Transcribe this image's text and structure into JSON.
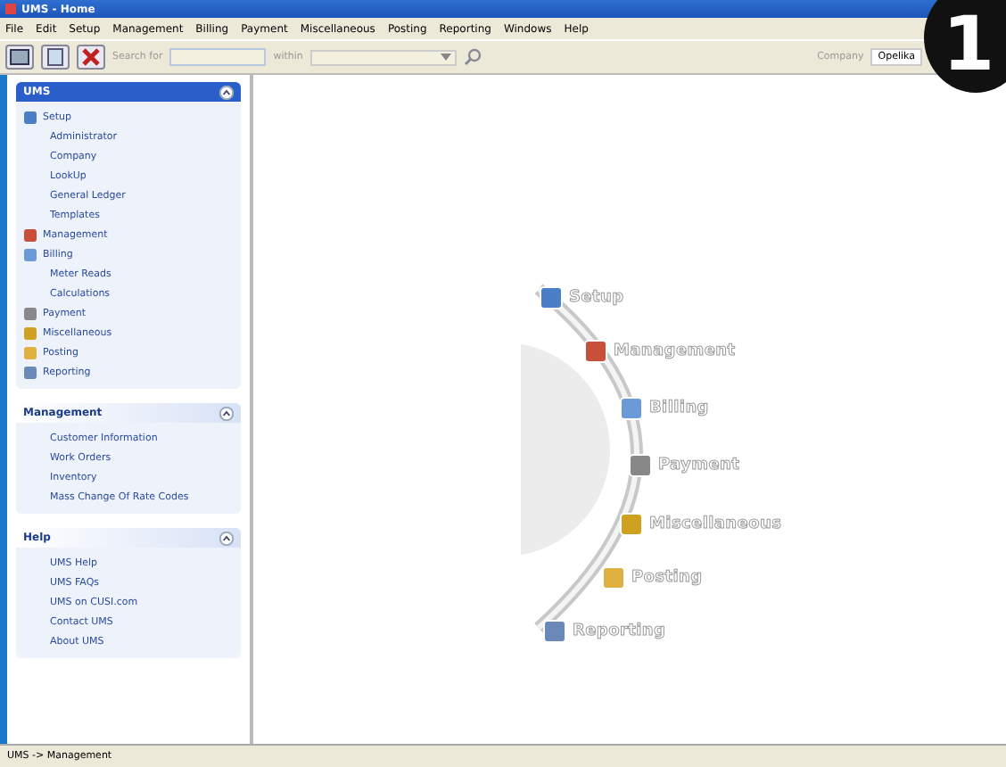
{
  "window": {
    "title": "UMS - Home"
  },
  "menu": [
    "File",
    "Edit",
    "Setup",
    "Management",
    "Billing",
    "Payment",
    "Miscellaneous",
    "Posting",
    "Reporting",
    "Windows",
    "Help"
  ],
  "toolbar": {
    "search_label": "Search for",
    "within_label": "within",
    "company_label": "Company",
    "company_value": "Opelika"
  },
  "badge": "1",
  "sidebar": {
    "panels": [
      {
        "title": "UMS",
        "selected": true,
        "items": [
          {
            "label": "Setup",
            "children": [
              {
                "label": "Administrator"
              },
              {
                "label": "Company"
              },
              {
                "label": "LookUp"
              },
              {
                "label": "General Ledger"
              },
              {
                "label": "Templates"
              }
            ]
          },
          {
            "label": "Management"
          },
          {
            "label": "Billing",
            "children": [
              {
                "label": "Meter Reads"
              },
              {
                "label": "Calculations"
              }
            ]
          },
          {
            "label": "Payment"
          },
          {
            "label": "Miscellaneous"
          },
          {
            "label": "Posting"
          },
          {
            "label": "Reporting"
          }
        ]
      },
      {
        "title": "Management",
        "selected": false,
        "items": [
          {
            "label": "Customer Information"
          },
          {
            "label": "Work Orders"
          },
          {
            "label": "Inventory"
          },
          {
            "label": "Mass Change Of Rate Codes"
          }
        ]
      },
      {
        "title": "Help",
        "selected": false,
        "items": [
          {
            "label": "UMS Help"
          },
          {
            "label": "UMS FAQs"
          },
          {
            "label": "UMS on CUSI.com"
          },
          {
            "label": "Contact UMS"
          },
          {
            "label": "About UMS"
          }
        ]
      }
    ]
  },
  "launcher": [
    "Setup",
    "Management",
    "Billing",
    "Payment",
    "Miscellaneous",
    "Posting",
    "Reporting"
  ],
  "status_bar": "UMS -> Management"
}
